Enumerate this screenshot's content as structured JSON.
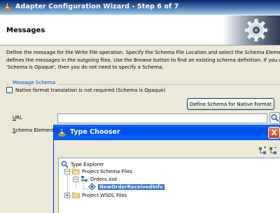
{
  "window": {
    "title": "Adapter Configuration Wizard - Step 6 of 7"
  },
  "header": {
    "page_title": "Messages"
  },
  "description": {
    "line1": "Define the message for the Write File operation.  Specify the Schema File Location and select the Schema Element th",
    "line2": "defines the messages in the outgoing files. Use the Browse button to find an existing schema definition. If you check",
    "line3": "'Schema is Opaque', then you do not need to specify a Schema."
  },
  "message_schema": {
    "group_label": "Message Schema",
    "opaque_checkbox_label": "Native format translation is not required (Schema is Opaque)",
    "opaque_checked": false,
    "define_button_label": "Define Schema for Native Format",
    "url_label_first": "U",
    "url_label_rest": "RL",
    "url_value": "",
    "schema_element_first": "S",
    "schema_element_rest": "chema Element"
  },
  "type_chooser": {
    "title": "Type Chooser",
    "close_label": "X",
    "tree": {
      "root": "Type Explorer",
      "project_schema_files": "Project Schema Files",
      "orders_xsd": "Orders.xsd",
      "selected_element": "NewOrderReceivedInfo",
      "project_wsdl_files": "Project WSDL Files",
      "expanded_glyph": "−",
      "collapsed_glyph": "+"
    }
  },
  "colors": {
    "titlebar_classic": "#0a246a",
    "titlebar_xp": "#0053ee",
    "selection": "#316ac5",
    "group_label": "#0046d5"
  }
}
